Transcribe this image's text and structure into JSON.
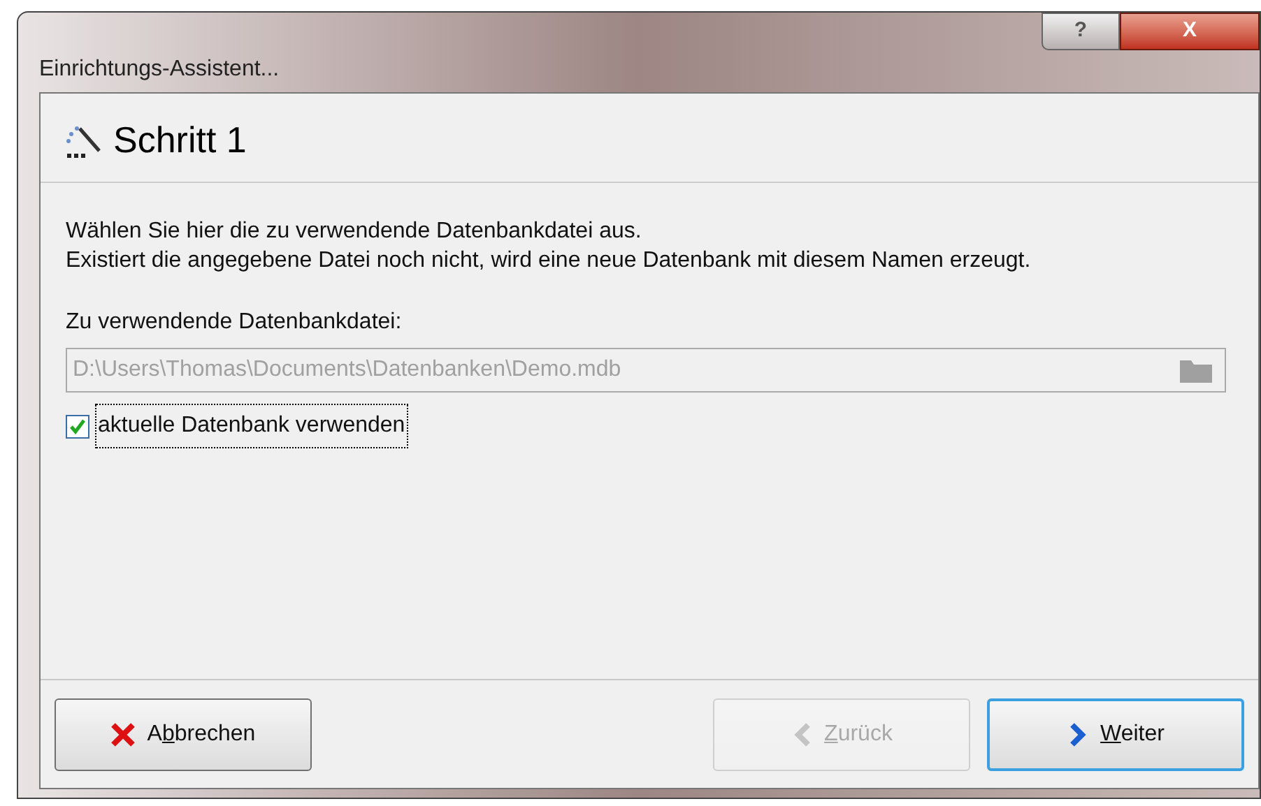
{
  "window": {
    "title": "Einrichtungs-Assistent...",
    "help_button": "?",
    "close_button": "X"
  },
  "header": {
    "title": "Schritt 1"
  },
  "description": [
    "Wählen Sie hier die zu verwendende Datenbankdatei aus.",
    "Existiert die angegebene Datei noch nicht, wird eine neue Datenbank mit diesem Namen erzeugt."
  ],
  "file_field": {
    "label": "Zu verwendende Datenbankdatei:",
    "value": "D:\\Users\\Thomas\\Documents\\Datenbanken\\Demo.mdb",
    "disabled": true
  },
  "checkbox": {
    "label": "aktuelle Datenbank verwenden",
    "checked": true
  },
  "buttons": [
    {
      "kind": "cancel",
      "label": {
        "before": "A",
        "key": "b",
        "after": "brechen"
      },
      "disabled": false,
      "selected": false
    },
    {
      "kind": "back",
      "label": {
        "key": "Z",
        "after": "urück"
      },
      "disabled": true,
      "selected": false
    },
    {
      "kind": "next",
      "label": {
        "key": "W",
        "after": "eiter"
      },
      "disabled": false,
      "selected": true
    }
  ]
}
